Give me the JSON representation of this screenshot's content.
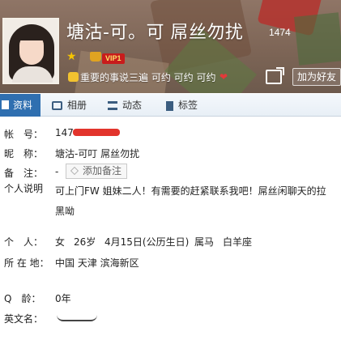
{
  "header": {
    "nickname": "塘沽-可。可 屌丝勿扰",
    "uin_partial": "1474",
    "vip_label": "VIP1",
    "signature": "重要的事说三遍 可约 可约 可约",
    "add_friend_label": "加为好友"
  },
  "tabs": [
    {
      "label": "资料",
      "active": true
    },
    {
      "label": "相册",
      "active": false
    },
    {
      "label": "动态",
      "active": false
    },
    {
      "label": "标签",
      "active": false
    }
  ],
  "profile": {
    "account_label": "帐　号：",
    "account_value": "147",
    "nickname_label": "昵　称：",
    "nickname_value": "塘沽-可叮 屌丝勿扰",
    "remark_label": "备　注：",
    "remark_prefix": "-",
    "remark_button": "添加备注",
    "intro_label": "个人说明",
    "intro_value": "可上门FW 姐妹二人！有需要的赶紧联系我吧！屌丝闲聊天的拉黑呦",
    "personal_label": "个　人：",
    "gender": "女",
    "age": "26岁",
    "birthday": "4月15日(公历生日)",
    "zodiac": "属马",
    "constellation": "白羊座",
    "location_label": "所 在 地：",
    "location_value": "中国 天津 滨海新区",
    "qage_label": "Q　龄：",
    "qage_value": "0年",
    "english_label": "英文名："
  },
  "colors": {
    "accent_tab": "#2f6fb0",
    "redaction": "#e2342c",
    "vip_badge": "#c81c1c"
  }
}
